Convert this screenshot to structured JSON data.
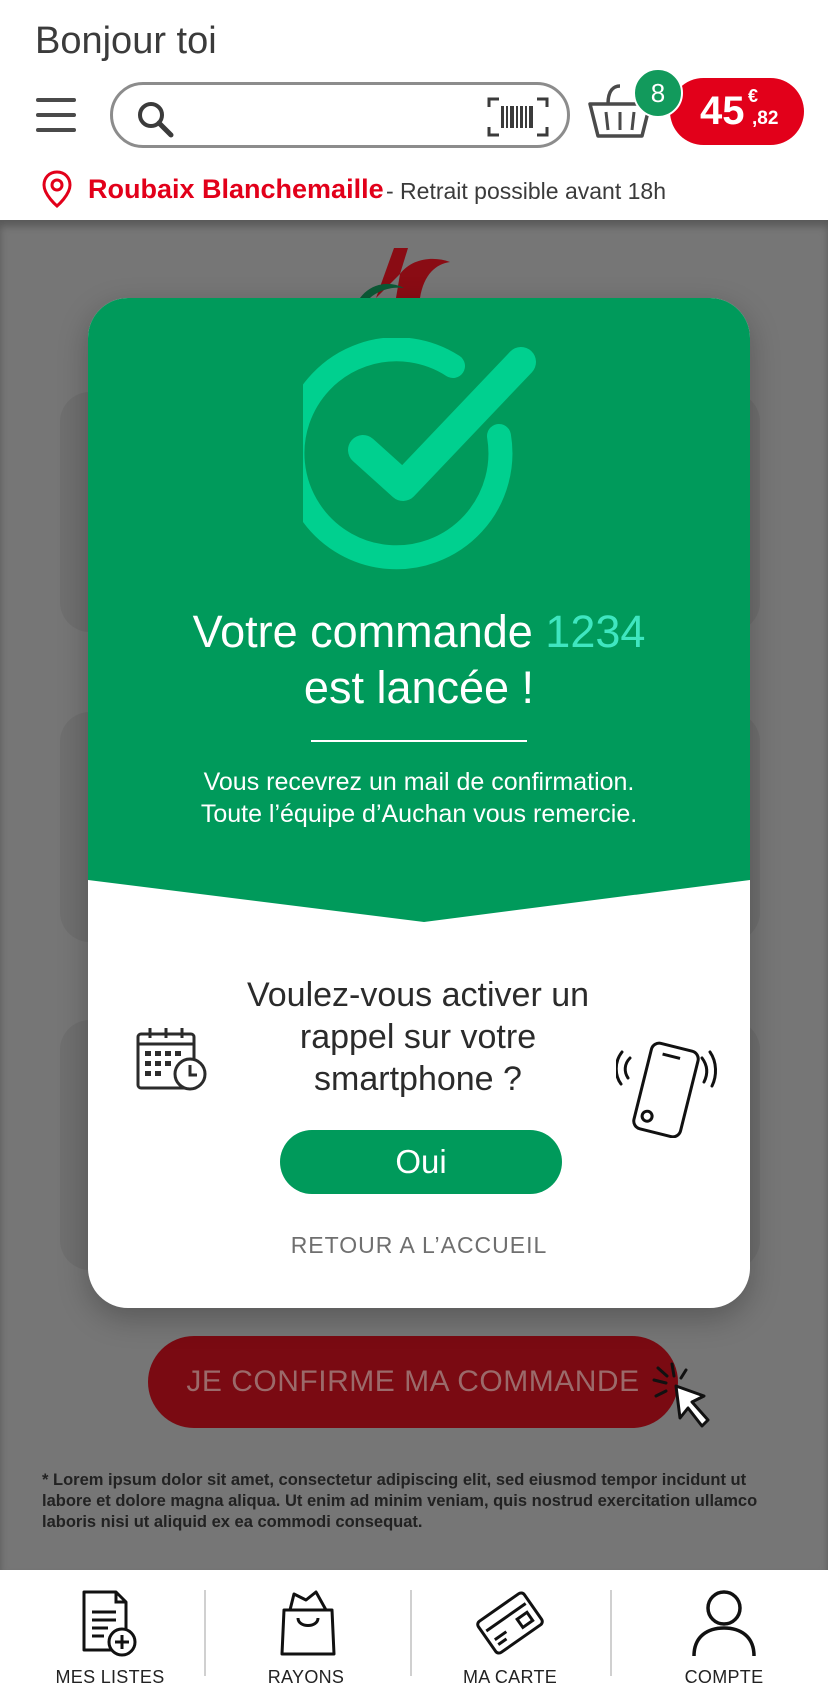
{
  "header": {
    "greeting": "Bonjour toi",
    "search": {
      "placeholder": "",
      "value": ""
    },
    "basket_count": "8",
    "price": {
      "main": "45",
      "currency": "€",
      "cents": ",82"
    }
  },
  "store": {
    "name": "Roubaix Blanchemaille",
    "info": "- Retrait possible avant 18h"
  },
  "background_page": {
    "confirm_button": "JE CONFIRME MA COMMANDE",
    "footnote": "* Lorem ipsum dolor sit amet, consectetur adipiscing elit, sed eiusmod tempor incidunt ut labore et dolore magna aliqua. Ut enim ad minim veniam, quis nostrud exercitation ullamco laboris nisi ut aliquid ex ea commodi consequat."
  },
  "modal": {
    "title_part1": "Votre commande",
    "order_number": "1234",
    "title_part2": "est lancée !",
    "message_line1": "Vous recevrez un mail de confirmation.",
    "message_line2": "Toute l’équipe d’Auchan vous remercie.",
    "question": "Voulez-vous activer un rappel sur votre smartphone ?",
    "yes_button": "Oui",
    "back_link": "RETOUR A L’ACCUEIL"
  },
  "bottom_nav": {
    "items": [
      {
        "label": "MES LISTES",
        "icon": "list-add-icon"
      },
      {
        "label": "RAYONS",
        "icon": "shopping-bag-icon"
      },
      {
        "label": "MA CARTE",
        "icon": "loyalty-card-icon"
      },
      {
        "label": "COMPTE",
        "icon": "user-icon"
      }
    ]
  },
  "colors": {
    "brand_red": "#e2001a",
    "brand_green": "#009a5b",
    "check_green": "#00d08f",
    "order_number": "#3fe6c0"
  }
}
